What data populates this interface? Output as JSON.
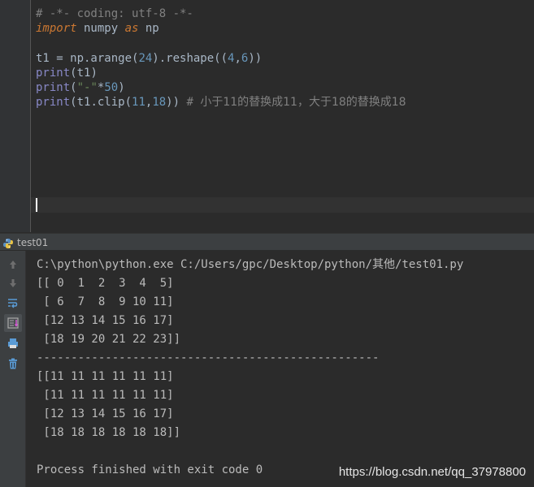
{
  "editor": {
    "lines": [
      [
        {
          "t": "# -*- coding: utf-8 -*-",
          "c": "comment"
        }
      ],
      [
        {
          "t": "import",
          "c": "kw"
        },
        {
          "t": " numpy ",
          "c": "plain"
        },
        {
          "t": "as",
          "c": "kw"
        },
        {
          "t": " np",
          "c": "plain"
        }
      ],
      [
        {
          "t": "",
          "c": "plain"
        }
      ],
      [
        {
          "t": "t1 = np.arange(",
          "c": "plain"
        },
        {
          "t": "24",
          "c": "num"
        },
        {
          "t": ").reshape((",
          "c": "plain"
        },
        {
          "t": "4",
          "c": "num"
        },
        {
          "t": ",",
          "c": "plain"
        },
        {
          "t": "6",
          "c": "num"
        },
        {
          "t": "))",
          "c": "plain"
        }
      ],
      [
        {
          "t": "print",
          "c": "builtin"
        },
        {
          "t": "(t1)",
          "c": "plain"
        }
      ],
      [
        {
          "t": "print",
          "c": "builtin"
        },
        {
          "t": "(",
          "c": "plain"
        },
        {
          "t": "\"-\"",
          "c": "str"
        },
        {
          "t": "*",
          "c": "plain"
        },
        {
          "t": "50",
          "c": "num"
        },
        {
          "t": ")",
          "c": "plain"
        }
      ],
      [
        {
          "t": "print",
          "c": "builtin"
        },
        {
          "t": "(t1.clip(",
          "c": "plain"
        },
        {
          "t": "11",
          "c": "num"
        },
        {
          "t": ",",
          "c": "plain"
        },
        {
          "t": "18",
          "c": "num"
        },
        {
          "t": ")) ",
          "c": "plain"
        },
        {
          "t": "# ",
          "c": "comment"
        },
        {
          "t": "小于11的替换成11，大于18的替换成18",
          "c": "cjk-comment"
        }
      ]
    ]
  },
  "run_tab": {
    "label": "test01",
    "icon": "python-icon"
  },
  "toolbar": {
    "buttons": [
      {
        "name": "rerun-up-icon",
        "glyph": "↑"
      },
      {
        "name": "rerun-down-icon",
        "glyph": "↓"
      },
      {
        "name": "soft-wrap-icon",
        "glyph": "⇄"
      },
      {
        "name": "scroll-to-end-icon",
        "glyph": "▤"
      },
      {
        "name": "print-icon",
        "glyph": "⎙"
      },
      {
        "name": "clear-all-icon",
        "glyph": "🗑"
      }
    ]
  },
  "console": {
    "lines": [
      "C:\\python\\python.exe C:/Users/gpc/Desktop/python/其他/test01.py",
      "[[ 0  1  2  3  4  5]",
      " [ 6  7  8  9 10 11]",
      " [12 13 14 15 16 17]",
      " [18 19 20 21 22 23]]",
      "--------------------------------------------------",
      "[[11 11 11 11 11 11]",
      " [11 11 11 11 11 11]",
      " [12 13 14 15 16 17]",
      " [18 18 18 18 18 18]]",
      "",
      "Process finished with exit code 0"
    ]
  },
  "watermark": "https://blog.csdn.net/qq_37978800",
  "colors": {
    "background": "#2b2b2b",
    "keyword": "#cc7832",
    "number": "#6897bb",
    "string": "#6a8759",
    "comment": "#808080",
    "builtin": "#8888c6",
    "text": "#a9b7c6"
  }
}
